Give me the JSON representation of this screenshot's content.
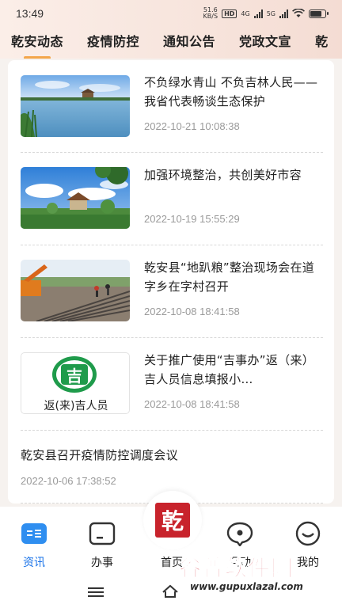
{
  "status_bar": {
    "time": "13:49",
    "speed_value": "51.6",
    "speed_unit": "KB/S",
    "hd_label": "HD",
    "net_4g": "4G",
    "net_5g": "5G",
    "icons": [
      "signal-icon",
      "wifi-icon",
      "battery-icon"
    ]
  },
  "tabs": [
    {
      "label": "乾安动态",
      "active": true
    },
    {
      "label": "疫情防控",
      "active": false
    },
    {
      "label": "通知公告",
      "active": false
    },
    {
      "label": "党政文宣",
      "active": false
    },
    {
      "label": "乾",
      "active": false
    }
  ],
  "news": [
    {
      "title": "不负绿水青山 不负吉林人民——我省代表畅谈生态保护",
      "date": "2022-10-21 10:08:38",
      "thumb": "lake-landscape"
    },
    {
      "title": "加强环境整治，共创美好市容",
      "date": "2022-10-19 15:55:29",
      "thumb": "village-sky"
    },
    {
      "title": "乾安县“地趴粮”整治现场会在道字乡在字村召开",
      "date": "2022-10-08 18:41:58",
      "thumb": "construction-site"
    },
    {
      "title": "关于推广使用“吉事办”返（来）吉人员信息填报小…",
      "date": "2022-10-08 18:41:58",
      "thumb": "ji-logo",
      "thumb_caption": "返(来)吉人员",
      "thumb_glyph": "吉"
    },
    {
      "title": "乾安县召开疫情防控调度会议",
      "date": "2022-10-06 17:38:52"
    }
  ],
  "bottom_nav": {
    "items": [
      {
        "label": "资讯",
        "icon": "news-icon",
        "active": true
      },
      {
        "label": "办事",
        "icon": "service-icon",
        "active": false
      },
      {
        "label": "首页",
        "icon": "home-seal-icon",
        "active": false
      },
      {
        "label": "互动",
        "icon": "chat-icon",
        "active": false
      },
      {
        "label": "我的",
        "icon": "profile-icon",
        "active": false
      }
    ],
    "home_glyph": "乾"
  },
  "watermark": {
    "main": "谷普软件园",
    "sub": "www.gupuxlazal.com"
  },
  "colors": {
    "accent": "#1a73e8",
    "tab_indicator": "#f3a64a",
    "seal_red": "#c8232c"
  }
}
